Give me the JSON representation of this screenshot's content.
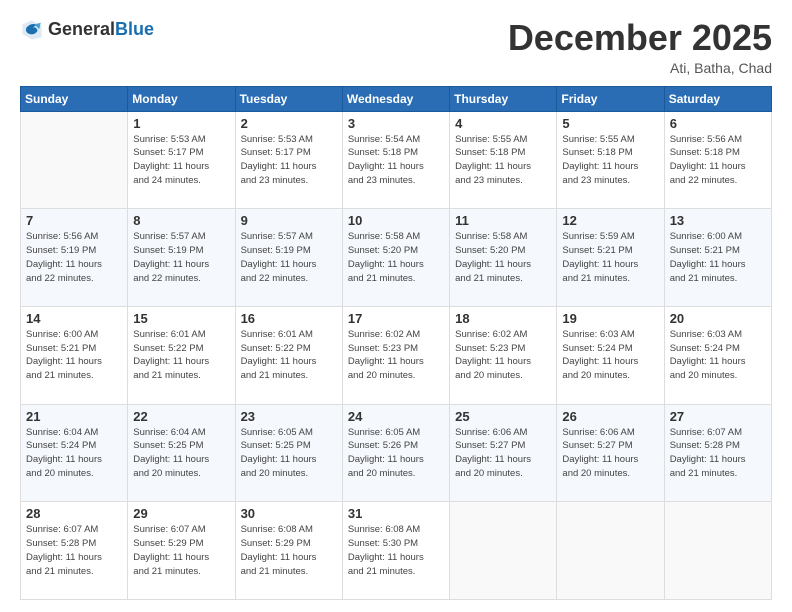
{
  "header": {
    "logo_general": "General",
    "logo_blue": "Blue",
    "month_title": "December 2025",
    "location": "Ati, Batha, Chad"
  },
  "calendar": {
    "days_of_week": [
      "Sunday",
      "Monday",
      "Tuesday",
      "Wednesday",
      "Thursday",
      "Friday",
      "Saturday"
    ],
    "weeks": [
      [
        {
          "day": "",
          "info": ""
        },
        {
          "day": "1",
          "info": "Sunrise: 5:53 AM\nSunset: 5:17 PM\nDaylight: 11 hours\nand 24 minutes."
        },
        {
          "day": "2",
          "info": "Sunrise: 5:53 AM\nSunset: 5:17 PM\nDaylight: 11 hours\nand 23 minutes."
        },
        {
          "day": "3",
          "info": "Sunrise: 5:54 AM\nSunset: 5:18 PM\nDaylight: 11 hours\nand 23 minutes."
        },
        {
          "day": "4",
          "info": "Sunrise: 5:55 AM\nSunset: 5:18 PM\nDaylight: 11 hours\nand 23 minutes."
        },
        {
          "day": "5",
          "info": "Sunrise: 5:55 AM\nSunset: 5:18 PM\nDaylight: 11 hours\nand 23 minutes."
        },
        {
          "day": "6",
          "info": "Sunrise: 5:56 AM\nSunset: 5:18 PM\nDaylight: 11 hours\nand 22 minutes."
        }
      ],
      [
        {
          "day": "7",
          "info": "Sunrise: 5:56 AM\nSunset: 5:19 PM\nDaylight: 11 hours\nand 22 minutes."
        },
        {
          "day": "8",
          "info": "Sunrise: 5:57 AM\nSunset: 5:19 PM\nDaylight: 11 hours\nand 22 minutes."
        },
        {
          "day": "9",
          "info": "Sunrise: 5:57 AM\nSunset: 5:19 PM\nDaylight: 11 hours\nand 22 minutes."
        },
        {
          "day": "10",
          "info": "Sunrise: 5:58 AM\nSunset: 5:20 PM\nDaylight: 11 hours\nand 21 minutes."
        },
        {
          "day": "11",
          "info": "Sunrise: 5:58 AM\nSunset: 5:20 PM\nDaylight: 11 hours\nand 21 minutes."
        },
        {
          "day": "12",
          "info": "Sunrise: 5:59 AM\nSunset: 5:21 PM\nDaylight: 11 hours\nand 21 minutes."
        },
        {
          "day": "13",
          "info": "Sunrise: 6:00 AM\nSunset: 5:21 PM\nDaylight: 11 hours\nand 21 minutes."
        }
      ],
      [
        {
          "day": "14",
          "info": "Sunrise: 6:00 AM\nSunset: 5:21 PM\nDaylight: 11 hours\nand 21 minutes."
        },
        {
          "day": "15",
          "info": "Sunrise: 6:01 AM\nSunset: 5:22 PM\nDaylight: 11 hours\nand 21 minutes."
        },
        {
          "day": "16",
          "info": "Sunrise: 6:01 AM\nSunset: 5:22 PM\nDaylight: 11 hours\nand 21 minutes."
        },
        {
          "day": "17",
          "info": "Sunrise: 6:02 AM\nSunset: 5:23 PM\nDaylight: 11 hours\nand 20 minutes."
        },
        {
          "day": "18",
          "info": "Sunrise: 6:02 AM\nSunset: 5:23 PM\nDaylight: 11 hours\nand 20 minutes."
        },
        {
          "day": "19",
          "info": "Sunrise: 6:03 AM\nSunset: 5:24 PM\nDaylight: 11 hours\nand 20 minutes."
        },
        {
          "day": "20",
          "info": "Sunrise: 6:03 AM\nSunset: 5:24 PM\nDaylight: 11 hours\nand 20 minutes."
        }
      ],
      [
        {
          "day": "21",
          "info": "Sunrise: 6:04 AM\nSunset: 5:24 PM\nDaylight: 11 hours\nand 20 minutes."
        },
        {
          "day": "22",
          "info": "Sunrise: 6:04 AM\nSunset: 5:25 PM\nDaylight: 11 hours\nand 20 minutes."
        },
        {
          "day": "23",
          "info": "Sunrise: 6:05 AM\nSunset: 5:25 PM\nDaylight: 11 hours\nand 20 minutes."
        },
        {
          "day": "24",
          "info": "Sunrise: 6:05 AM\nSunset: 5:26 PM\nDaylight: 11 hours\nand 20 minutes."
        },
        {
          "day": "25",
          "info": "Sunrise: 6:06 AM\nSunset: 5:27 PM\nDaylight: 11 hours\nand 20 minutes."
        },
        {
          "day": "26",
          "info": "Sunrise: 6:06 AM\nSunset: 5:27 PM\nDaylight: 11 hours\nand 20 minutes."
        },
        {
          "day": "27",
          "info": "Sunrise: 6:07 AM\nSunset: 5:28 PM\nDaylight: 11 hours\nand 21 minutes."
        }
      ],
      [
        {
          "day": "28",
          "info": "Sunrise: 6:07 AM\nSunset: 5:28 PM\nDaylight: 11 hours\nand 21 minutes."
        },
        {
          "day": "29",
          "info": "Sunrise: 6:07 AM\nSunset: 5:29 PM\nDaylight: 11 hours\nand 21 minutes."
        },
        {
          "day": "30",
          "info": "Sunrise: 6:08 AM\nSunset: 5:29 PM\nDaylight: 11 hours\nand 21 minutes."
        },
        {
          "day": "31",
          "info": "Sunrise: 6:08 AM\nSunset: 5:30 PM\nDaylight: 11 hours\nand 21 minutes."
        },
        {
          "day": "",
          "info": ""
        },
        {
          "day": "",
          "info": ""
        },
        {
          "day": "",
          "info": ""
        }
      ]
    ]
  }
}
